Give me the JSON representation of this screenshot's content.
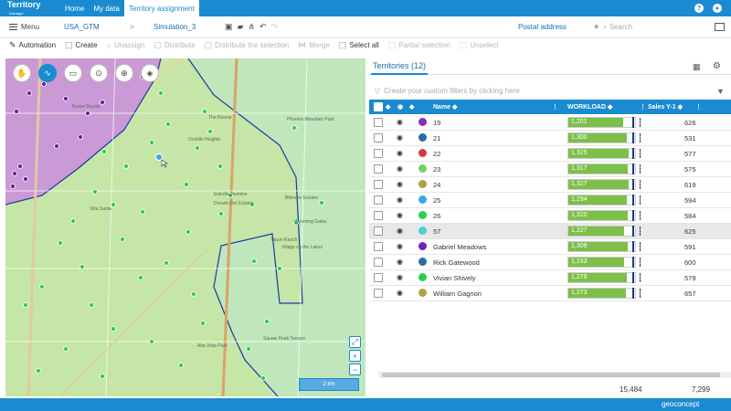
{
  "app": {
    "logo_main": "Territory",
    "logo_sub": "manager"
  },
  "nav": {
    "home": "Home",
    "mydata": "My data",
    "territory": "Territory assignment"
  },
  "header_icons": {
    "help": "?",
    "user": "person-icon"
  },
  "bar": {
    "menu": "Menu",
    "workspace": "USA_GTM",
    "separator": ">",
    "simulation": "Simulation_3",
    "address": "Postal address",
    "search_placeholder": "Search"
  },
  "toolbar": {
    "automation": "Automation",
    "create": "Create",
    "unassign": "Unassign",
    "distribute": "Distribute",
    "distribute_sel": "Distribute the selection",
    "merge": "Merge",
    "select_all": "Select all",
    "partial": "Partial selection",
    "unselect": "Unselect"
  },
  "map": {
    "scale": "2 km",
    "labels": [
      "Tempe Royale",
      "The Roosie",
      "Ocotillo Heights",
      "Phoenix Mountain Park",
      "Estrella Jasmine",
      "Dorado Del Estates",
      "Biltmore Estates",
      "Villa Santa",
      "Wyoming Gates",
      "Tatum Ranch",
      "Village on the Lakes",
      "Squaw Peak Terrace",
      "Alta Vista Park"
    ]
  },
  "panel": {
    "tab": "Territories (12)",
    "filter_placeholder": "Create your custom filters by clicking here",
    "columns": {
      "name": "Name",
      "workload": "WORKLOAD",
      "sales": "Sales Y-1"
    },
    "rows": [
      {
        "name": "19",
        "color": "#8a2cb5",
        "workload": "1,201",
        "fill": 0.82,
        "sales": "626",
        "selected": false
      },
      {
        "name": "21",
        "color": "#2f6aa7",
        "workload": "1,300",
        "fill": 0.88,
        "sales": "531",
        "selected": false
      },
      {
        "name": "22",
        "color": "#d83a3a",
        "workload": "1,325",
        "fill": 0.9,
        "sales": "577",
        "selected": false
      },
      {
        "name": "23",
        "color": "#6fd36a",
        "workload": "1,317",
        "fill": 0.89,
        "sales": "575",
        "selected": false
      },
      {
        "name": "24",
        "color": "#b0a244",
        "workload": "1,327",
        "fill": 0.9,
        "sales": "619",
        "selected": false
      },
      {
        "name": "25",
        "color": "#39a8e8",
        "workload": "1,294",
        "fill": 0.88,
        "sales": "594",
        "selected": false
      },
      {
        "name": "26",
        "color": "#2ecc52",
        "workload": "1,320",
        "fill": 0.89,
        "sales": "584",
        "selected": false
      },
      {
        "name": "57",
        "color": "#4fd0d0",
        "workload": "1,227",
        "fill": 0.83,
        "sales": "625",
        "selected": true
      },
      {
        "name": "Gabriel Meadows",
        "color": "#7a22b0",
        "workload": "1,309",
        "fill": 0.89,
        "sales": "591",
        "selected": false
      },
      {
        "name": "Rick Gatewood",
        "color": "#2f6aa7",
        "workload": "1,233",
        "fill": 0.84,
        "sales": "600",
        "selected": false
      },
      {
        "name": "Vivian Shively",
        "color": "#2ecc52",
        "workload": "1,279",
        "fill": 0.87,
        "sales": "579",
        "selected": false
      },
      {
        "name": "William Gagnon",
        "color": "#b0a244",
        "workload": "1,273",
        "fill": 0.86,
        "sales": "657",
        "selected": false
      }
    ],
    "total_workload": "15,484",
    "total_sales": "7,299"
  },
  "footer": {
    "brand": "geoconcept"
  }
}
